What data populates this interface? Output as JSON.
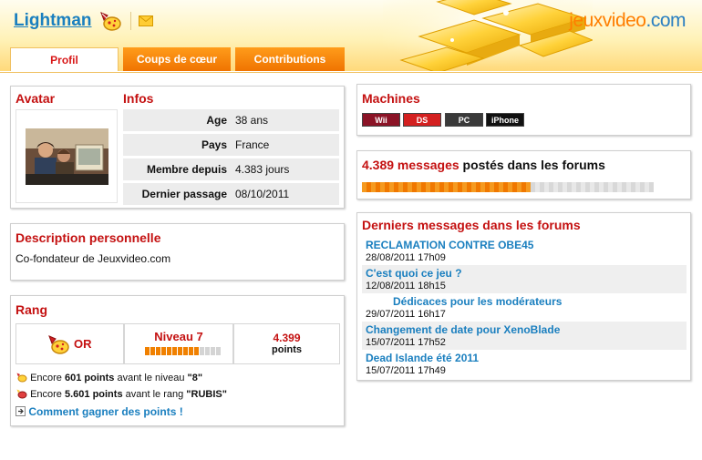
{
  "header": {
    "username": "Lightman",
    "logo_part1": "jeuxvideo",
    "logo_part2": ".com"
  },
  "tabs": [
    {
      "label": "Profil",
      "active": true
    },
    {
      "label": "Coups de cœur",
      "active": false
    },
    {
      "label": "Contributions",
      "active": false
    }
  ],
  "profile": {
    "avatar_title": "Avatar",
    "infos_title": "Infos",
    "infos": [
      {
        "label": "Age",
        "value": "38 ans"
      },
      {
        "label": "Pays",
        "value": "France"
      },
      {
        "label": "Membre depuis",
        "value": "4.383 jours"
      },
      {
        "label": "Dernier passage",
        "value": "08/10/2011"
      }
    ]
  },
  "description": {
    "title": "Description personnelle",
    "text": "Co-fondateur de Jeuxvideo.com"
  },
  "rang": {
    "title": "Rang",
    "rank_name": "OR",
    "level_label": "Niveau 7",
    "level_progress": 0.7,
    "points_value": "4.399",
    "points_label": "points",
    "next_level_prefix": "Encore",
    "next_level_points": "601 points",
    "next_level_mid": "avant le niveau",
    "next_level_target": "\"8\"",
    "next_rank_prefix": "Encore",
    "next_rank_points": "5.601 points",
    "next_rank_mid": "avant le rang",
    "next_rank_target": "\"RUBIS\"",
    "how_link": "Comment gagner des points !"
  },
  "machines": {
    "title": "Machines",
    "items": [
      {
        "label": "Wii",
        "color": "#8b1326"
      },
      {
        "label": "DS",
        "color": "#d42020"
      },
      {
        "label": "PC",
        "color": "#3a3a3a"
      },
      {
        "label": "iPhone",
        "color": "#111111"
      }
    ]
  },
  "messages": {
    "count": "4.389 messages",
    "suffix": "postés dans les forums",
    "progress": 0.58
  },
  "last_messages": {
    "title": "Derniers messages dans les forums",
    "items": [
      {
        "title": "RECLAMATION CONTRE OBE45",
        "date": "28/08/2011 17h09"
      },
      {
        "title": "C'est quoi ce jeu ?",
        "date": "12/08/2011 18h15"
      },
      {
        "title": "Dédicaces pour les modérateurs",
        "date": "29/07/2011 16h17"
      },
      {
        "title": "Changement de date pour XenoBlade",
        "date": "15/07/2011 17h52"
      },
      {
        "title": "Dead Islande été 2011",
        "date": "15/07/2011 17h49"
      }
    ]
  }
}
